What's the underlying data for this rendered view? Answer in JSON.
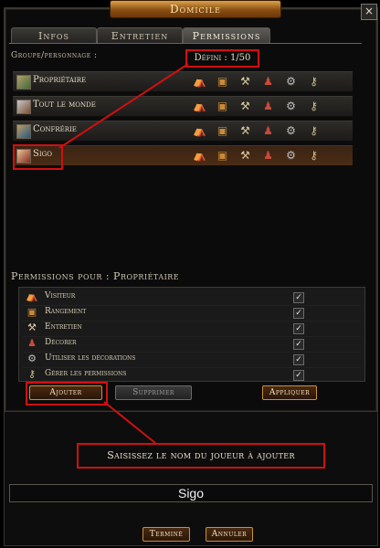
{
  "window": {
    "title": "Domicile",
    "close_label": "×"
  },
  "tabs": [
    {
      "label": "Infos",
      "active": false
    },
    {
      "label": "Entretien",
      "active": false
    },
    {
      "label": "Permissions",
      "active": true
    }
  ],
  "group_label": "Groupe/personnage :",
  "defined_count": "Défini : 1/50",
  "rows": [
    {
      "name": "Propriétaire",
      "avatar": "owner-avatar-icon"
    },
    {
      "name": "Tout le monde",
      "avatar": "everyone-avatar-icon"
    },
    {
      "name": "Confrérie",
      "avatar": "kinship-avatar-icon"
    },
    {
      "name": "Sigo",
      "avatar": "character-avatar-icon"
    }
  ],
  "row_permission_icons": [
    {
      "name": "visitor-icon",
      "glyph": "⛺",
      "color": "#c9c9b0"
    },
    {
      "name": "storage-chest-icon",
      "glyph": "▣",
      "color": "#c98a3a"
    },
    {
      "name": "maintenance-tools-icon",
      "glyph": "⚒",
      "color": "#d8c8a0"
    },
    {
      "name": "decorate-figure-icon",
      "glyph": "♟",
      "color": "#c84a3a"
    },
    {
      "name": "use-decorations-gear-icon",
      "glyph": "⚙",
      "color": "#bfbfbf"
    },
    {
      "name": "manage-permissions-key-icon",
      "glyph": "⚷",
      "color": "#d0c090"
    }
  ],
  "perm_title": "Permissions pour : Propriétaire",
  "permissions": [
    {
      "label": "Visiteur",
      "checked": "✓",
      "icon": "visitor-icon",
      "glyph": "⛺"
    },
    {
      "label": "Rangement",
      "checked": "✓",
      "icon": "storage-chest-icon",
      "glyph": "▣"
    },
    {
      "label": "Entretien",
      "checked": "✓",
      "icon": "maintenance-tools-icon",
      "glyph": "⚒"
    },
    {
      "label": "Décorer",
      "checked": "✓",
      "icon": "decorate-figure-icon",
      "glyph": "♟"
    },
    {
      "label": "Utiliser les décorations",
      "checked": "✓",
      "icon": "use-decorations-gear-icon",
      "glyph": "⚙"
    },
    {
      "label": "Gérer les permissions",
      "checked": "✓",
      "icon": "manage-permissions-key-icon",
      "glyph": "⚷"
    }
  ],
  "buttons": {
    "add": "Ajouter",
    "remove": "Supprimer",
    "apply": "Appliquer"
  },
  "dialog": {
    "message": "Saisissez le nom du joueur à ajouter",
    "input_value": "Sigo",
    "ok": "Terminé",
    "cancel": "Annuler"
  },
  "colors": {
    "highlight": "#d01010",
    "accent_gold": "#c98f3c"
  }
}
